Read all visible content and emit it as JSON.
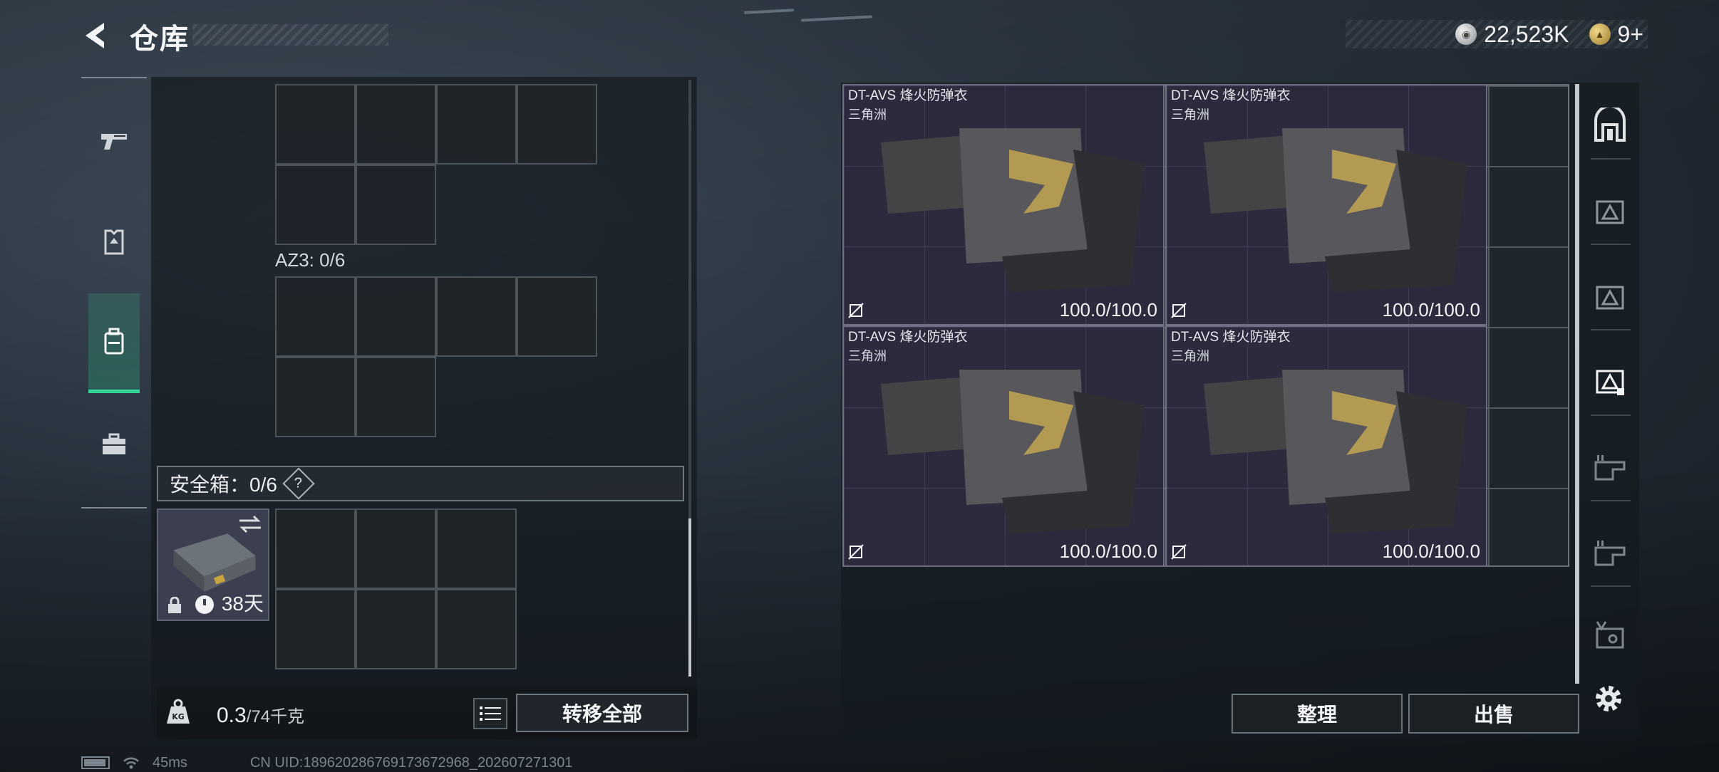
{
  "header": {
    "title": "仓库",
    "currency": [
      {
        "icon": "silver-coin-icon",
        "value": "22,523K"
      },
      {
        "icon": "gold-coin-icon",
        "value": "9+"
      }
    ]
  },
  "tabs": [
    {
      "name": "tab-weapons",
      "icon": "pistol-icon"
    },
    {
      "name": "tab-equipment",
      "icon": "armor-icon"
    },
    {
      "name": "tab-backpack",
      "icon": "backpack-icon",
      "active": true
    },
    {
      "name": "tab-toolbox",
      "icon": "toolbox-icon"
    }
  ],
  "left": {
    "az_label": "AZ3: 0/6",
    "safe_box_label": "安全箱：0/6",
    "help_symbol": "?",
    "case_days": "38天",
    "weight_current": "0.3",
    "weight_max": "/74千克",
    "transfer_all": "转移全部"
  },
  "items": [
    {
      "name": "DT-AVS 烽火防弹衣",
      "sub": "三角洲",
      "durability": "100.0/100.0"
    },
    {
      "name": "DT-AVS 烽火防弹衣",
      "sub": "三角洲",
      "durability": "100.0/100.0"
    },
    {
      "name": "DT-AVS 烽火防弹衣",
      "sub": "三角洲",
      "durability": "100.0/100.0"
    },
    {
      "name": "DT-AVS 烽火防弹衣",
      "sub": "三角洲",
      "durability": "100.0/100.0"
    }
  ],
  "right": {
    "sort": "整理",
    "sell": "出售"
  },
  "status": {
    "ping": "45ms",
    "uid": "CN UID:18962028676917367296​8_202607271301"
  },
  "colors": {
    "accent_active_tab": "#35d59a",
    "item_bg": "#2c2b3d"
  }
}
